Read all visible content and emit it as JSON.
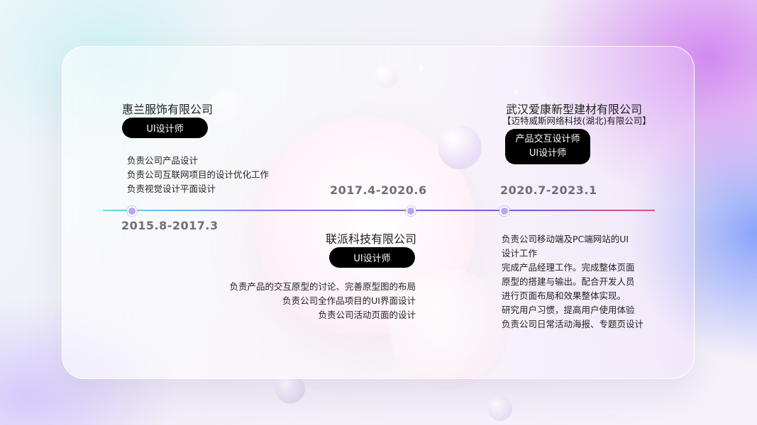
{
  "colors": {
    "pill_bg": "#000000",
    "pill_text": "#ffffff",
    "date_text": "#6e6e78",
    "timeline_start": "#5fe3ea",
    "timeline_end": "#e0567a",
    "node_fill": "#b7a6f4"
  },
  "experiences": [
    {
      "company": "惠兰服饰有限公司",
      "role": "UI设计师",
      "period": "2015.8-2017.3",
      "duties": [
        "负责公司产品设计",
        "负责公司互联网项目的设计优化工作",
        "负责视觉设计平面设计"
      ]
    },
    {
      "company": "联派科技有限公司",
      "role": "UI设计师",
      "period": "2017.4-2020.6",
      "duties": [
        "负责产品的交互原型的讨论、完善原型图的布局",
        "负责公司全作品项目的UI界面设计",
        "负责公司活动页面的设计"
      ]
    },
    {
      "company": "武汉爱康新型建材有限公司",
      "sub_company": "【迈特威斯网络科技(湖北)有限公司】",
      "roles": [
        "产品交互设计师",
        "UI设计师"
      ],
      "period": "2020.7-2023.1",
      "duties": [
        "负责公司移动端及PC端网站的UI",
        "设计工作",
        "完成产品经理工作。完成整体页面",
        "原型的搭建与输出。配合开发人员",
        "进行页面布局和效果整体实现。",
        "研究用户习惯，提高用户使用体验",
        "负责公司日常活动海报、专题页设计"
      ]
    }
  ]
}
